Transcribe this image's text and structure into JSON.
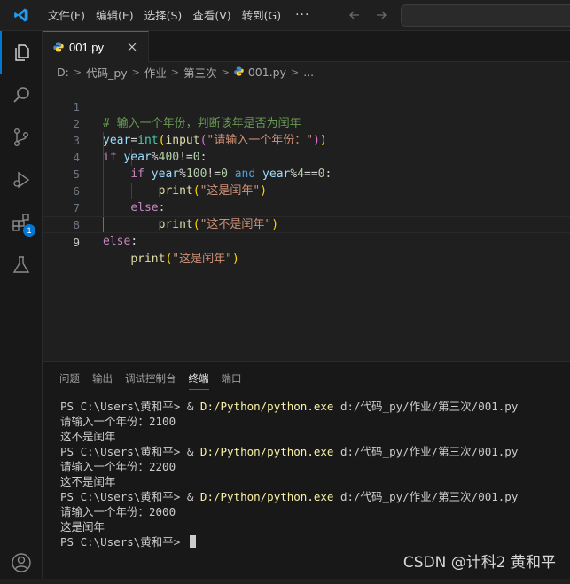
{
  "menu": {
    "items": [
      "文件(F)",
      "编辑(E)",
      "选择(S)",
      "查看(V)",
      "转到(G)"
    ],
    "more": "···"
  },
  "tab": {
    "label": "001.py"
  },
  "breadcrumb": [
    "D:",
    "代码_py",
    "作业",
    "第三次",
    "001.py",
    "..."
  ],
  "editor": {
    "line_numbers": [
      "1",
      "2",
      "3",
      "4",
      "5",
      "6",
      "7",
      "8",
      "9"
    ],
    "current_line": "9"
  },
  "panel": {
    "tabs": [
      "问题",
      "输出",
      "调试控制台",
      "终端",
      "端口"
    ],
    "active_tab": "终端"
  },
  "terminal": {
    "prompt": "PS C:\\Users\\黄和平> ",
    "amp": "& ",
    "exe": "D:/Python/python.exe",
    "script": " d:/代码_py/作业/第三次/001.py",
    "runs": [
      {
        "input_line": "请输入一个年份：2100",
        "output_line": "这不是闰年"
      },
      {
        "input_line": "请输入一个年份：2200",
        "output_line": "这不是闰年"
      },
      {
        "input_line": "请输入一个年份：2000",
        "output_line": "这是闰年"
      }
    ],
    "final_prompt": "PS C:\\Users\\黄和平> "
  },
  "watermark": "CSDN @计科2 黄和平",
  "activity_badge": "1",
  "colors": {
    "accent": "#0078d4",
    "editor_bg": "#1f1f1f",
    "panel_bg": "#181818"
  }
}
